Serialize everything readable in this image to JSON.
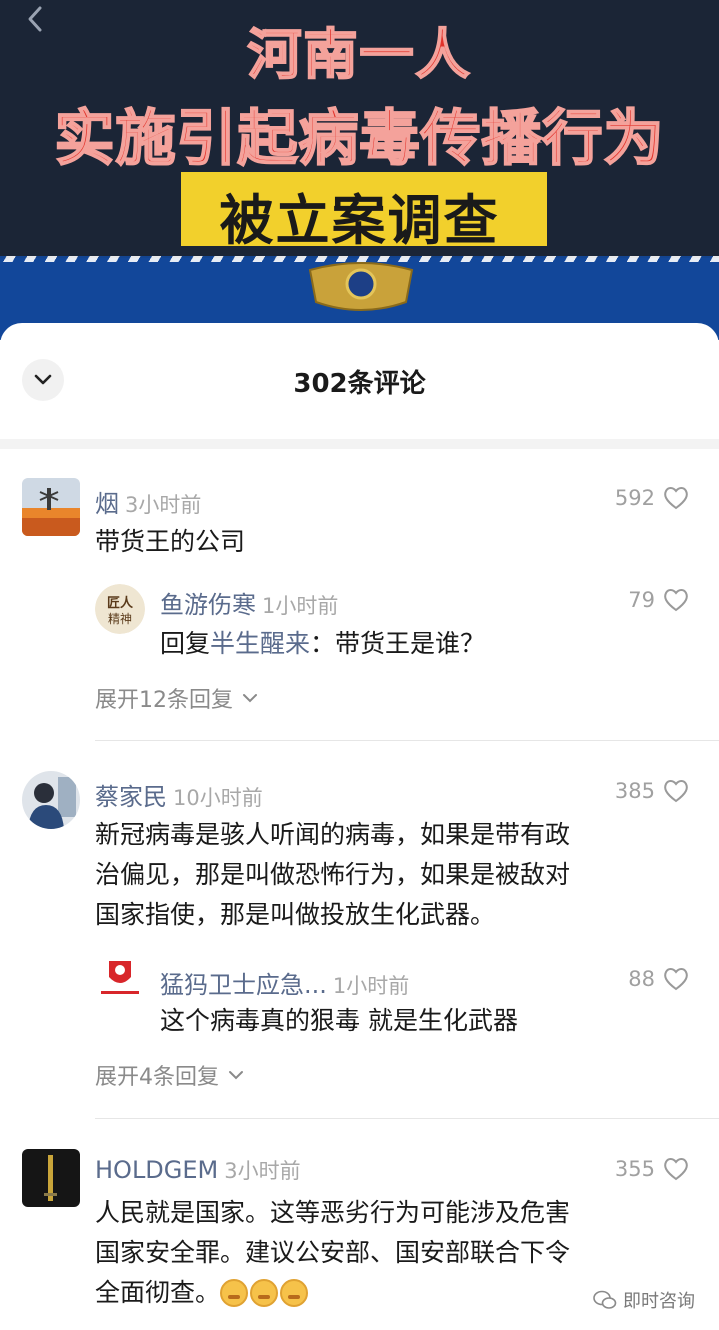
{
  "video": {
    "headline_line1": "河南一人",
    "headline_line2": "实施引起病毒传播行为",
    "headline_line3": "被立案调查"
  },
  "sheet": {
    "title": "302条评论"
  },
  "comments": [
    {
      "username": "烟",
      "time": "3小时前",
      "likes": "592",
      "text": "带货王的公司",
      "reply": {
        "username": "鱼游伤寒",
        "time": "1小时前",
        "likes": "79",
        "prefix": "回复",
        "mention": "半生醒来",
        "text": "：带货王是谁？"
      },
      "expand_label": "展开12条回复"
    },
    {
      "username": "蔡家民",
      "time": "10小时前",
      "likes": "385",
      "text_lines": [
        "新冠病毒是骇人听闻的病毒，如果是带有政",
        "治偏见，那是叫做恐怖行为，如果是被敌对",
        "国家指使，那是叫做投放生化武器。"
      ],
      "reply": {
        "username": "猛犸卫士应急...",
        "time": "1小时前",
        "likes": "88",
        "text": "这个病毒真的狠毒  就是生化武器"
      },
      "expand_label": "展开4条回复"
    },
    {
      "username": "HOLDGEM",
      "time": "3小时前",
      "likes": "355",
      "text_lines": [
        "人民就是国家。这等恶劣行为可能涉及危害",
        "国家安全罪。建议公安部、国安部联合下令",
        "全面彻查。"
      ]
    }
  ],
  "watermark": "即时咨询",
  "colors": {
    "accent_name": "#5a6b8c",
    "headline_red": "#e2322a",
    "headline_yellow": "#f2d02c"
  }
}
